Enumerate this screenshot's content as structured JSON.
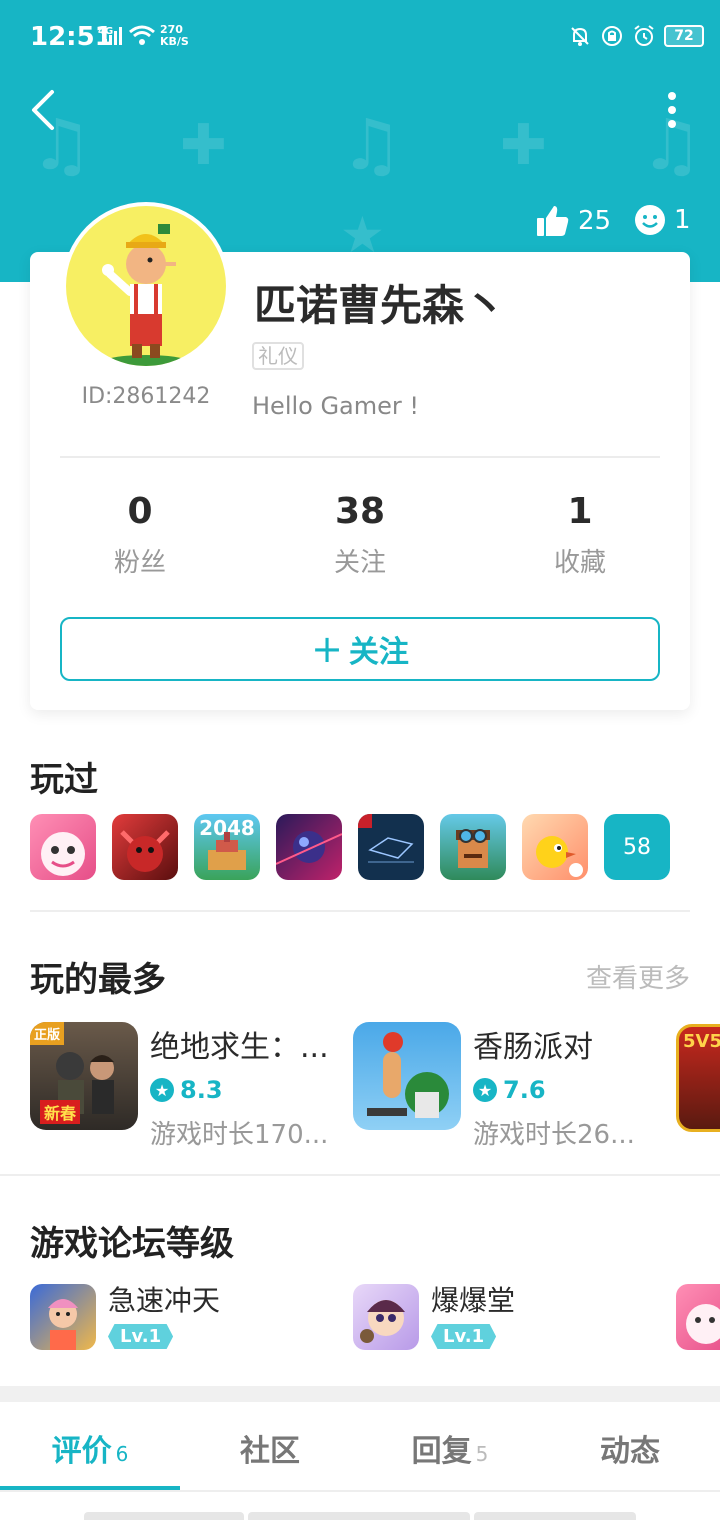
{
  "status_bar": {
    "time": "12:51",
    "network": "4G",
    "speed_value": "270",
    "speed_unit": "KB/S",
    "battery": "72"
  },
  "header": {
    "likes": "25",
    "visitors": "1"
  },
  "profile": {
    "username": "匹诺曹先森丶",
    "tag": "礼仪",
    "user_id": "ID:2861242",
    "bio": "Hello Gamer !"
  },
  "stats": [
    {
      "value": "0",
      "label": "粉丝"
    },
    {
      "value": "38",
      "label": "关注"
    },
    {
      "value": "1",
      "label": "收藏"
    }
  ],
  "follow_button": {
    "icon": "+",
    "label": "关注"
  },
  "played": {
    "title": "玩过",
    "more_count": "58",
    "icons": [
      "pink-monster-game-icon",
      "red-creature-game-icon",
      "2048-game-icon",
      "space-ball-game-icon",
      "blueprint-game-icon",
      "pilot-character-game-icon",
      "yellow-bird-game-icon"
    ],
    "icon_2048_text": "2048"
  },
  "most_played": {
    "title": "玩的最多",
    "see_more": "查看更多",
    "items": [
      {
        "name": "绝地求生：...",
        "score": "8.3",
        "time": "游戏时长170...",
        "icon_badge_top": "正版",
        "icon_badge_bottom": "新春"
      },
      {
        "name": "香肠派对",
        "score": "7.6",
        "time": "游戏时长26..."
      }
    ],
    "partial_icon_text": "5V5"
  },
  "forum_level": {
    "title": "游戏论坛等级",
    "items": [
      {
        "name": "急速冲天",
        "level": "Lv.1"
      },
      {
        "name": "爆爆堂",
        "level": "Lv.1"
      }
    ]
  },
  "tabs": [
    {
      "label": "评价",
      "count": "6",
      "active": true
    },
    {
      "label": "社区",
      "count": "",
      "active": false
    },
    {
      "label": "回复",
      "count": "5",
      "active": false
    },
    {
      "label": "动态",
      "count": "",
      "active": false
    }
  ],
  "colors": {
    "accent": "#17b5c5",
    "badge": "#5fd1dd",
    "avatar_bg": "#f7ef63"
  }
}
